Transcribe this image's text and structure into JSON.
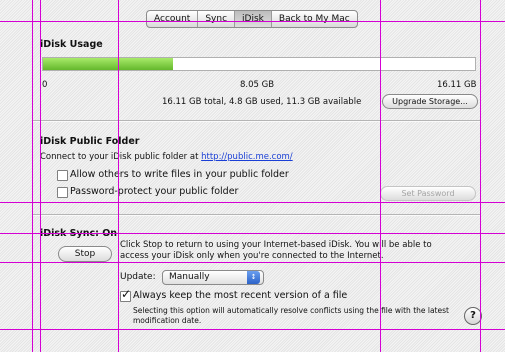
{
  "tabs": [
    {
      "label": "Account"
    },
    {
      "label": "Sync"
    },
    {
      "label": "iDisk"
    },
    {
      "label": "Back to My Mac"
    }
  ],
  "usage": {
    "title": "iDisk Usage",
    "used_fraction": 0.3,
    "tick_min": "0",
    "tick_mid": "8.05 GB",
    "tick_max": "16.11 GB",
    "summary": "16.11 GB total, 4.8 GB used, 11.3 GB available",
    "upgrade_button": "Upgrade Storage..."
  },
  "public_folder": {
    "title": "iDisk Public Folder",
    "connect_text": "Connect to your iDisk public folder at",
    "link": "http://public.me.com/",
    "allow_write_label": "Allow others to write files in your public folder",
    "password_label": "Password-protect your public folder",
    "set_password_button": "Set Password"
  },
  "sync": {
    "title": "iDisk Sync: On",
    "stop_button": "Stop",
    "description": "Click Stop to return to using your Internet-based iDisk. You will be able to access your iDisk only when you're connected to the Internet.",
    "update_label": "Update:",
    "update_value": "Manually",
    "keep_label": "Always keep the most recent version of a file",
    "keep_checkmark": "✓",
    "keep_description": "Selecting this option will automatically resolve conflicts using the file with the latest modification date.",
    "help_label": "?"
  },
  "colors": {
    "guide_lines": "#d400d4",
    "usage_fill": "#7ccf3a"
  }
}
